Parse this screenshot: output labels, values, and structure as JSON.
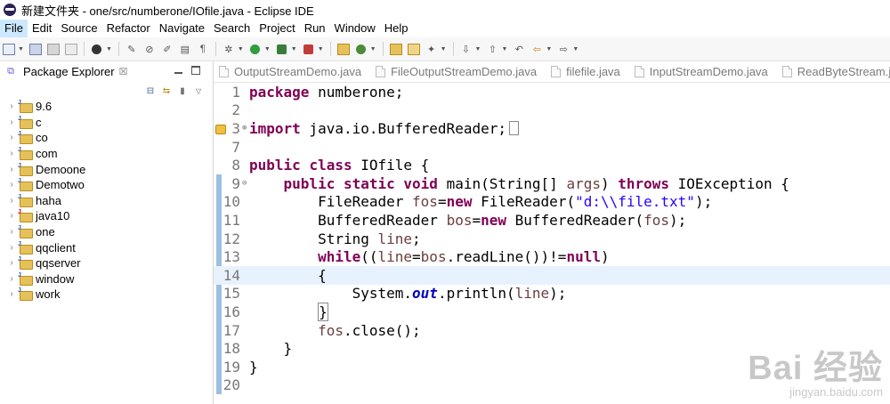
{
  "window": {
    "title": "新建文件夹 - one/src/numberone/IOfile.java - Eclipse IDE"
  },
  "menu": [
    "File",
    "Edit",
    "Source",
    "Refactor",
    "Navigate",
    "Search",
    "Project",
    "Run",
    "Window",
    "Help"
  ],
  "explorer": {
    "title": "Package Explorer",
    "close": "☒",
    "projects": [
      "9.6",
      "c",
      "co",
      "com",
      "Demoone",
      "Demotwo",
      "haha",
      "java10",
      "one",
      "qqclient",
      "qqserver",
      "window",
      "work"
    ]
  },
  "editor_tabs": [
    "OutputStreamDemo.java",
    "FileOutputStreamDemo.java",
    "filefile.java",
    "InputStreamDemo.java",
    "ReadByteStream.java"
  ],
  "code": {
    "line_numbers": [
      "1",
      "2",
      "3",
      "7",
      "8",
      "9",
      "10",
      "11",
      "12",
      "13",
      "14",
      "15",
      "16",
      "17",
      "18",
      "19",
      "20"
    ],
    "l1": {
      "kw": "package",
      "rest": " numberone;"
    },
    "l3": {
      "kw": "import",
      "rest": " java.io.BufferedReader;"
    },
    "l8": {
      "kw1": "public",
      "kw2": "class",
      "rest": " IOfile {"
    },
    "l9": {
      "indent": "    ",
      "kw1": "public",
      "kw2": "static",
      "kw3": "void",
      "a": " main(String[] ",
      "var": "args",
      "b": ") ",
      "kw4": "throws",
      "c": " IOException {"
    },
    "l10": {
      "indent": "        ",
      "a": "FileReader ",
      "var": "fos",
      "b": "=",
      "kw": "new",
      "c": " FileReader(",
      "str": "\"d:\\\\file.txt\"",
      "d": ");"
    },
    "l11": {
      "indent": "        ",
      "a": "BufferedReader ",
      "var": "bos",
      "b": "=",
      "kw": "new",
      "c": " BufferedReader(",
      "var2": "fos",
      "d": ");"
    },
    "l12": {
      "indent": "        ",
      "a": "String ",
      "var": "line",
      "b": ";"
    },
    "l13": {
      "indent": "        ",
      "kw": "while",
      "a": "((",
      "var": "line",
      "b": "=",
      "var2": "bos",
      "c": ".readLine())!=",
      "kw2": "null",
      "d": ")"
    },
    "l14": {
      "indent": "        ",
      "text": "{"
    },
    "l15": {
      "indent": "            ",
      "a": "System.",
      "fld": "out",
      "b": ".println(",
      "var": "line",
      "c": ");"
    },
    "l16": {
      "indent": "        ",
      "text": "}"
    },
    "l17": {
      "indent": "        ",
      "var": "fos",
      "a": ".close();"
    },
    "l18": {
      "indent": "    ",
      "text": "}"
    },
    "l19": {
      "text": "}"
    }
  },
  "watermark": {
    "logo": "Bai 经验",
    "url": "jingyan.baidu.com"
  },
  "colors": {
    "keyword": "#7f0055",
    "string": "#2a00ff",
    "local_var": "#6a3e3e",
    "field": "#0000c0",
    "current_line": "#e8f2fe"
  }
}
